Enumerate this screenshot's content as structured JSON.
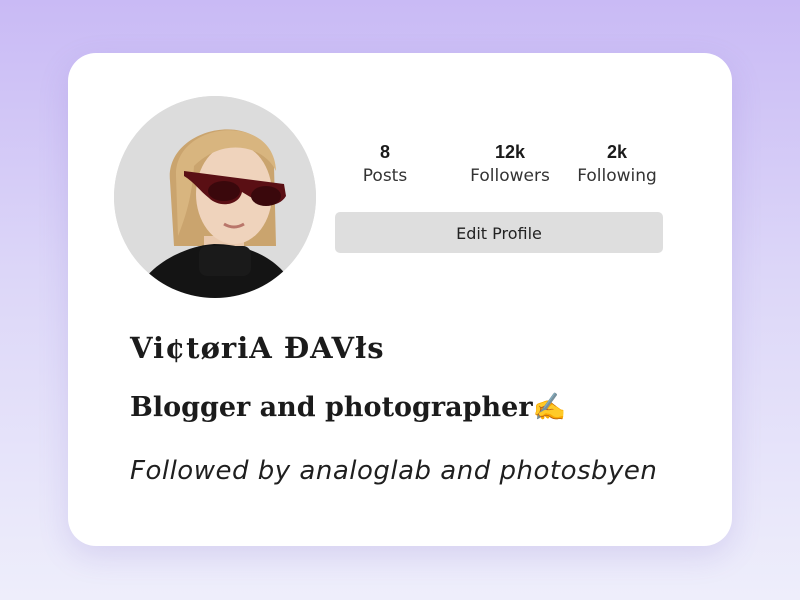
{
  "profile": {
    "name": "Vi¢tøriA ĐAVłs",
    "bio": "Blogger and photographer✍",
    "followed_by": "Followed by analoglab and photosbyen"
  },
  "stats": {
    "posts": {
      "value": "8",
      "label": "Posts"
    },
    "followers": {
      "value": "12k",
      "label": "Followers"
    },
    "following": {
      "value": "2k",
      "label": "Following"
    }
  },
  "actions": {
    "edit_profile": "Edit Profile"
  },
  "colors": {
    "background_top": "#c9baf5",
    "card": "#ffffff",
    "button": "#dedede",
    "text": "#1b1b1b"
  }
}
